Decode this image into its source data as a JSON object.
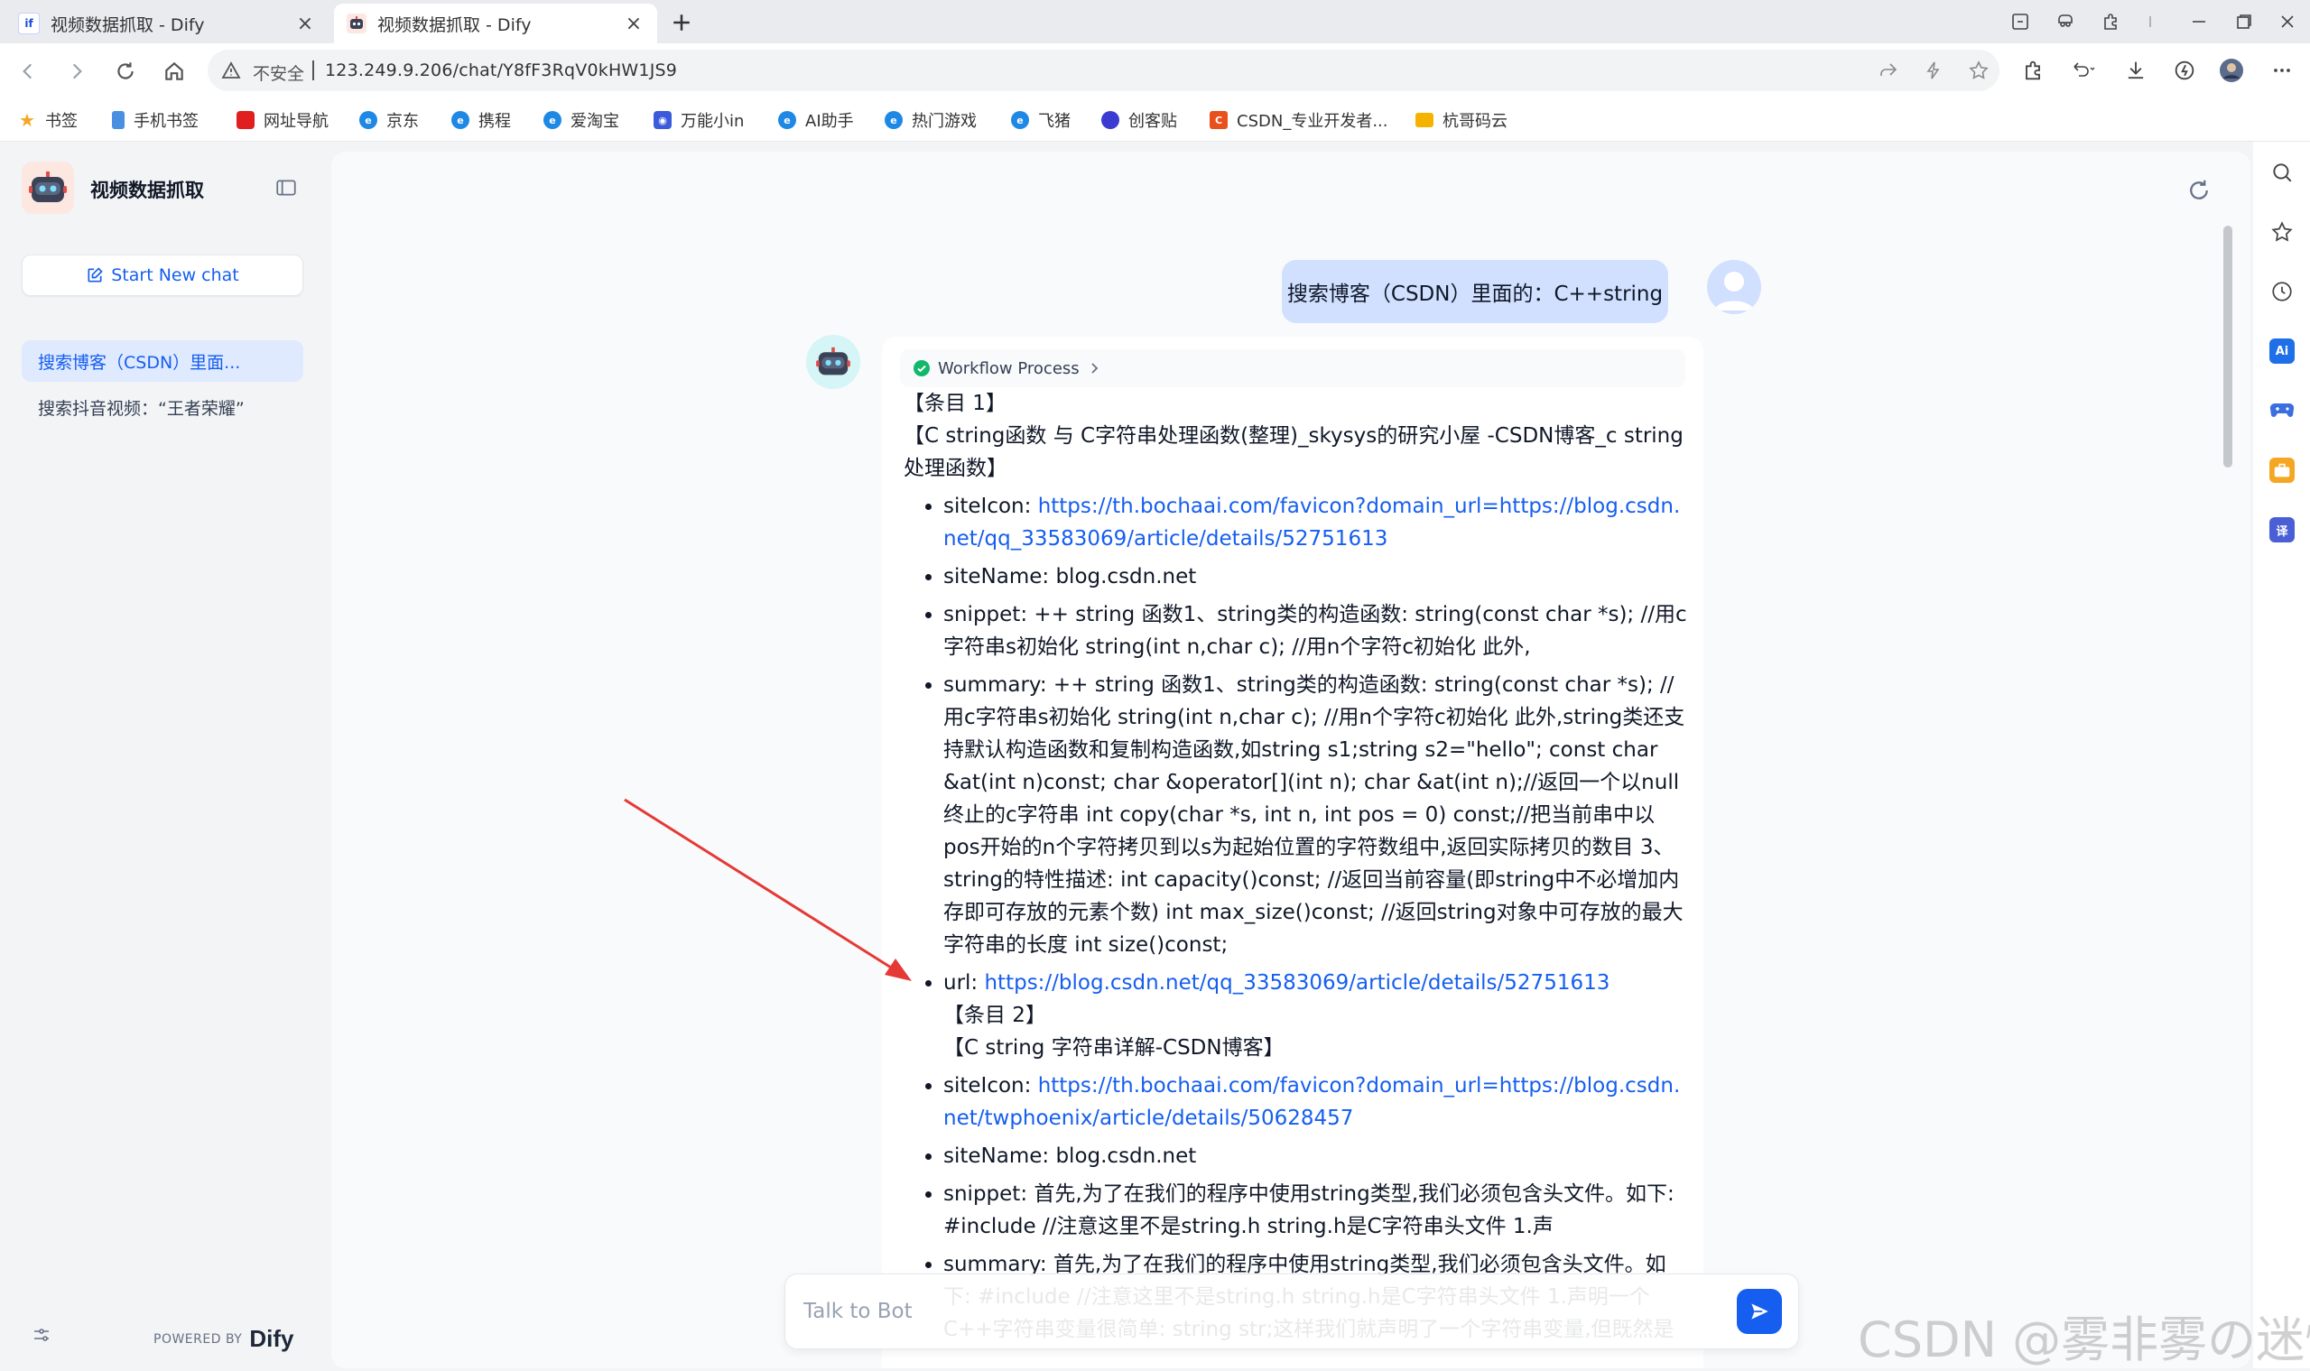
{
  "browser": {
    "tabs": [
      {
        "title": "视频数据抓取 - Dify",
        "fav_text": "if"
      },
      {
        "title": "视频数据抓取 - Dify",
        "fav_text": ""
      }
    ],
    "insecure_label": "不安全",
    "url": "123.249.9.206/chat/Y8fF3RqV0kHW1JS9",
    "bookmarks": [
      {
        "label": "书签",
        "color": "#f5a623"
      },
      {
        "label": "手机书签",
        "color": "#4a90e2"
      },
      {
        "label": "网址导航",
        "color": "#e02020"
      },
      {
        "label": "京东",
        "color": "#1e88e5"
      },
      {
        "label": "携程",
        "color": "#1e88e5"
      },
      {
        "label": "爱淘宝",
        "color": "#1e88e5"
      },
      {
        "label": "万能小in",
        "color": "#3b5bdb"
      },
      {
        "label": "AI助手",
        "color": "#1e88e5"
      },
      {
        "label": "热门游戏",
        "color": "#1e88e5"
      },
      {
        "label": "飞猪",
        "color": "#1e88e5"
      },
      {
        "label": "创客贴",
        "color": "#3b3bd1"
      },
      {
        "label": "CSDN_专业开发者...",
        "color": "#e8501e",
        "fav_text": "C"
      },
      {
        "label": "杭哥码云",
        "color": "#f5b300"
      }
    ]
  },
  "sidebar": {
    "app_name": "视频数据抓取",
    "new_chat_label": "Start New chat",
    "conversations": [
      {
        "label": "搜索博客（CSDN）里面..."
      },
      {
        "label": "搜索抖音视频：“王者荣耀”"
      }
    ],
    "powered_by": "POWERED BY",
    "brand": "Dify"
  },
  "chat": {
    "user_message": "搜索博客（CSDN）里面的：C++string",
    "workflow_label": "Workflow Process",
    "item1_label": "【条目 1】",
    "item1_title": "【C string函数 与 C字符串处理函数(整理)_skysys的研究小屋 -CSDN博客_c string处理函数】",
    "site_icon_key": "siteIcon: ",
    "item1_site_icon": "https://th.bochaai.com/favicon?domain_url=https://blog.csdn.net/qq_33583069/article/details/52751613",
    "item1_site_name": "siteName: blog.csdn.net",
    "item1_snippet": "snippet: ++ string 函数1、string类的构造函数: string(const char *s); //用c字符串s初始化 string(int n,char c); //用n个字符c初始化 此外,",
    "item1_summary": "summary: ++ string 函数1、string类的构造函数: string(const char *s); //用c字符串s初始化 string(int n,char c); //用n个字符c初始化 此外,string类还支持默认构造函数和复制构造函数,如string s1;string s2=\"hello\"; const char &at(int n)const; char &operator[](int n); char &at(int n);//返回一个以null终止的c字符串 int copy(char *s, int n, int pos = 0) const;//把当前串中以pos开始的n个字符拷贝到以s为起始位置的字符数组中,返回实际拷贝的数目 3、string的特性描述: int capacity()const; //返回当前容量(即string中不必增加内存即可存放的元素个数) int max_size()const; //返回string对象中可存放的最大字符串的长度 int size()const;",
    "url_key": "url: ",
    "item1_url": "https://blog.csdn.net/qq_33583069/article/details/52751613",
    "item2_label": "【条目 2】",
    "item2_title": "【C string 字符串详解-CSDN博客】",
    "item2_site_icon": "https://th.bochaai.com/favicon?domain_url=https://blog.csdn.net/twphoenix/article/details/50628457",
    "item2_site_name": "siteName: blog.csdn.net",
    "item2_snippet": "snippet: 首先,为了在我们的程序中使用string类型,我们必须包含头文件。如下: #include //注意这里不是string.h string.h是C字符串头文件 1.声",
    "item2_summary": "summary: 首先,为了在我们的程序中使用string类型,我们必须包含头文件。如下: #include //注意这里不是string.h string.h是C字符串头文件 1.声明一个C++字符串变量很简单: string str;这样我们就声明了一个字符串变量,但既然是",
    "input_placeholder": "Talk to Bot"
  },
  "watermark": "CSDN @雾非雾の迷惘",
  "colors": {
    "accent": "#155eef",
    "user_bubble": "#d1e0ff",
    "active_conv": "#e0eaff",
    "arrow": "#e53935"
  }
}
